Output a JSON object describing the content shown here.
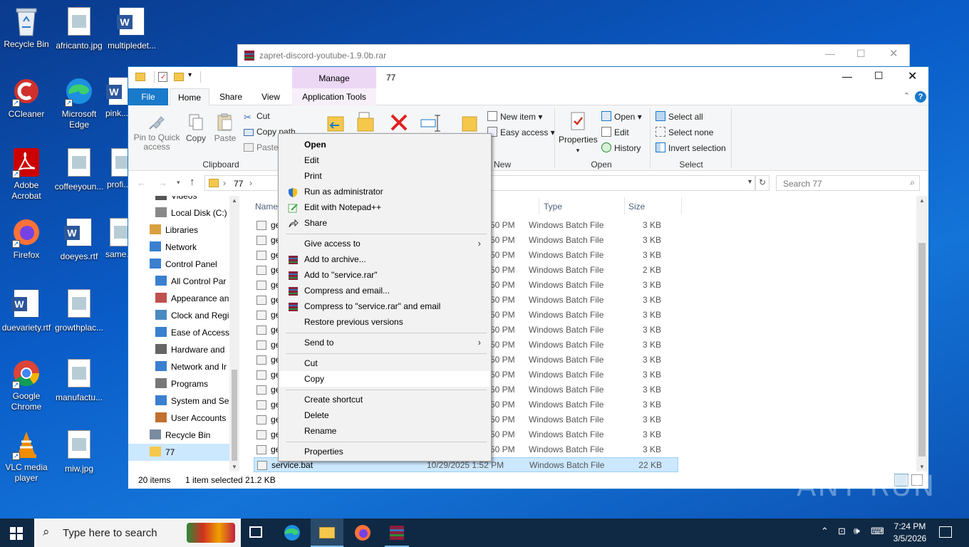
{
  "desktop": {
    "icons": [
      {
        "label": "Recycle Bin"
      },
      {
        "label": "africanto.jpg"
      },
      {
        "label": "multipledet..."
      },
      {
        "label": "CCleaner"
      },
      {
        "label": "Microsoft Edge"
      },
      {
        "label": "pink..."
      },
      {
        "label": "Adobe Acrobat"
      },
      {
        "label": "coffeeyoun..."
      },
      {
        "label": "profi..."
      },
      {
        "label": "Firefox"
      },
      {
        "label": "doeyes.rtf"
      },
      {
        "label": "same..."
      },
      {
        "label": "duevariety.rtf"
      },
      {
        "label": "growthplac..."
      },
      {
        "label": "Google Chrome"
      },
      {
        "label": "manufactu..."
      },
      {
        "label": "VLC media player"
      },
      {
        "label": "miw.jpg"
      }
    ]
  },
  "rar_window": {
    "title": "zapret-discord-youtube-1.9.0b.rar"
  },
  "explorer": {
    "title": "77",
    "context_tab": "Manage",
    "tabs": {
      "file": "File",
      "home": "Home",
      "share": "Share",
      "view": "View",
      "apptools": "Application Tools"
    },
    "ribbon": {
      "pin": "Pin to Quick access",
      "copy": "Copy",
      "paste": "Paste",
      "cut": "Cut",
      "copy_path": "Copy path",
      "paste_shortcut": "Paste s",
      "clipboard": "Clipboard",
      "new_item": "New item",
      "easy_access": "Easy access",
      "new": "New",
      "properties": "Properties",
      "open_btn": "Open",
      "edit": "Edit",
      "history": "History",
      "open_group": "Open",
      "select_all": "Select all",
      "select_none": "Select none",
      "invert": "Invert selection",
      "select_group": "Select"
    },
    "address": {
      "path": "77",
      "search_placeholder": "Search 77"
    },
    "nav": [
      {
        "label": "Videos"
      },
      {
        "label": "Local Disk (C:)"
      },
      {
        "label": "Libraries"
      },
      {
        "label": "Network"
      },
      {
        "label": "Control Panel"
      },
      {
        "label": "All Control Par"
      },
      {
        "label": "Appearance an"
      },
      {
        "label": "Clock and Regi"
      },
      {
        "label": "Ease of Access"
      },
      {
        "label": "Hardware and"
      },
      {
        "label": "Network and Ir"
      },
      {
        "label": "Programs"
      },
      {
        "label": "System and Se"
      },
      {
        "label": "User Accounts"
      },
      {
        "label": "Recycle Bin"
      },
      {
        "label": "77"
      }
    ],
    "columns": {
      "name": "Name",
      "type": "Type",
      "size": "Size"
    },
    "rows": [
      {
        "name": "ge",
        "date": "50 PM",
        "type": "Windows Batch File",
        "size": "3 KB"
      },
      {
        "name": "ge",
        "date": "50 PM",
        "type": "Windows Batch File",
        "size": "3 KB"
      },
      {
        "name": "ge",
        "date": "50 PM",
        "type": "Windows Batch File",
        "size": "3 KB"
      },
      {
        "name": "ge",
        "date": "50 PM",
        "type": "Windows Batch File",
        "size": "2 KB"
      },
      {
        "name": "ge",
        "date": "50 PM",
        "type": "Windows Batch File",
        "size": "3 KB"
      },
      {
        "name": "ge",
        "date": "50 PM",
        "type": "Windows Batch File",
        "size": "3 KB"
      },
      {
        "name": "ge",
        "date": "50 PM",
        "type": "Windows Batch File",
        "size": "3 KB"
      },
      {
        "name": "ge",
        "date": "50 PM",
        "type": "Windows Batch File",
        "size": "3 KB"
      },
      {
        "name": "ge",
        "date": "50 PM",
        "type": "Windows Batch File",
        "size": "3 KB"
      },
      {
        "name": "ge",
        "date": "50 PM",
        "type": "Windows Batch File",
        "size": "3 KB"
      },
      {
        "name": "ge",
        "date": "50 PM",
        "type": "Windows Batch File",
        "size": "3 KB"
      },
      {
        "name": "ge",
        "date": "50 PM",
        "type": "Windows Batch File",
        "size": "3 KB"
      },
      {
        "name": "ge",
        "date": "50 PM",
        "type": "Windows Batch File",
        "size": "3 KB"
      },
      {
        "name": "ge",
        "date": "50 PM",
        "type": "Windows Batch File",
        "size": "3 KB"
      },
      {
        "name": "ge",
        "date": "50 PM",
        "type": "Windows Batch File",
        "size": "3 KB"
      },
      {
        "name": "ge",
        "date": "50 PM",
        "type": "Windows Batch File",
        "size": "3 KB"
      },
      {
        "name": "service.bat",
        "date": "10/29/2025 1:52 PM",
        "type": "Windows Batch File",
        "size": "22 KB"
      }
    ],
    "status": {
      "count": "20 items",
      "selected": "1 item selected  21.2 KB"
    }
  },
  "context_menu": {
    "open": "Open",
    "edit": "Edit",
    "print": "Print",
    "run_admin": "Run as administrator",
    "notepadpp": "Edit with Notepad++",
    "share": "Share",
    "give_access": "Give access to",
    "add_archive": "Add to archive...",
    "add_rar": "Add to \"service.rar\"",
    "compress_email": "Compress and email...",
    "compress_rar_email": "Compress to \"service.rar\" and email",
    "restore": "Restore previous versions",
    "send_to": "Send to",
    "cut": "Cut",
    "copy": "Copy",
    "create_shortcut": "Create shortcut",
    "delete": "Delete",
    "rename": "Rename",
    "properties": "Properties"
  },
  "taskbar": {
    "search": "Type here to search",
    "time": "7:24 PM",
    "date": "3/5/2026"
  },
  "watermark": "ANY RUN"
}
